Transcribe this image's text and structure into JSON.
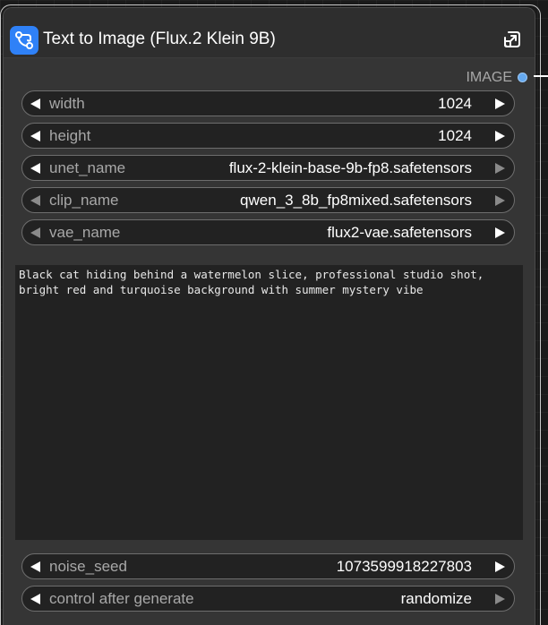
{
  "node": {
    "title": "Text to Image (Flux.2 Klein 9B)",
    "icon": "subgraph-icon",
    "header_action_icon": "open-subgraph-icon",
    "output": {
      "label": "IMAGE",
      "color": "#65a9ef"
    }
  },
  "widgets": {
    "width": {
      "label": "width",
      "value": "1024"
    },
    "height": {
      "label": "height",
      "value": "1024"
    },
    "unet_name": {
      "label": "unet_name",
      "value": "flux-2-klein-base-9b-fp8.safetensors"
    },
    "clip_name": {
      "label": "clip_name",
      "value": "qwen_3_8b_fp8mixed.safetensors"
    },
    "vae_name": {
      "label": "vae_name",
      "value": "flux2-vae.safetensors"
    },
    "noise_seed": {
      "label": "noise_seed",
      "value": "1073599918227803"
    },
    "control_after_generate": {
      "label": "control after generate",
      "value": "randomize"
    }
  },
  "prompt": {
    "text": "Black cat hiding behind a watermelon slice, professional studio shot, bright red and turquoise background with summer mystery vibe"
  },
  "colors": {
    "accent": "#2f81f7",
    "node_body": "#353535",
    "widget_bg": "#222222",
    "canvas": "#1a1a1a"
  }
}
